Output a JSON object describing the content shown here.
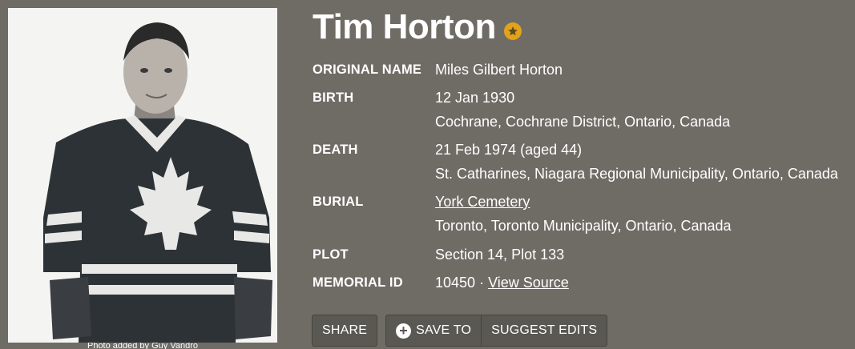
{
  "memorial": {
    "name": "Tim Horton",
    "photo_caption": "Photo added by Guy Vandro",
    "facts": {
      "original_name": {
        "label": "ORIGINAL NAME",
        "value": "Miles Gilbert Horton"
      },
      "birth": {
        "label": "BIRTH",
        "date": "12 Jan 1930",
        "place": "Cochrane, Cochrane District, Ontario, Canada"
      },
      "death": {
        "label": "DEATH",
        "date": "21 Feb 1974 (aged 44)",
        "place": "St. Catharines, Niagara Regional Municipality, Ontario, Canada"
      },
      "burial": {
        "label": "BURIAL",
        "cemetery": "York Cemetery",
        "place": "Toronto, Toronto Municipality, Ontario, Canada"
      },
      "plot": {
        "label": "PLOT",
        "value": "Section 14, Plot 133"
      },
      "memorial_id": {
        "label": "MEMORIAL ID",
        "value": "10450",
        "separator": "·",
        "view_source": "View Source"
      }
    }
  },
  "actions": {
    "share": "SHARE",
    "save_to": "SAVE TO",
    "suggest_edits": "SUGGEST EDITS"
  },
  "icons": {
    "famous_badge": "star-badge-icon",
    "save": "plus-circle-icon"
  },
  "colors": {
    "background": "#6f6c66",
    "button": "#5a5853",
    "badge": "#e3a21a"
  }
}
